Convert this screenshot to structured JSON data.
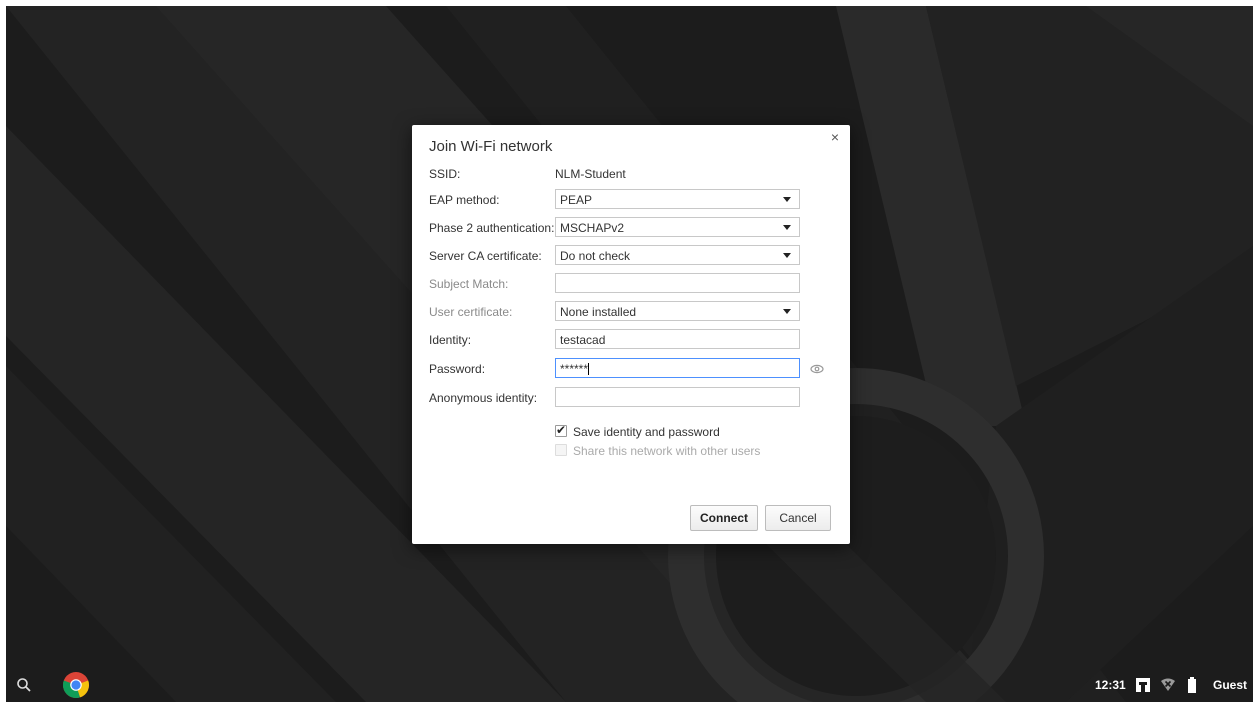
{
  "dialog": {
    "title": "Join Wi-Fi network",
    "close_symbol": "×",
    "ssid_label": "SSID:",
    "ssid_value": "NLM-Student",
    "eap_label": "EAP method:",
    "eap_value": "PEAP",
    "phase2_label": "Phase 2 authentication:",
    "phase2_value": "MSCHAPv2",
    "server_ca_label": "Server CA certificate:",
    "server_ca_value": "Do not check",
    "subject_match_label": "Subject Match:",
    "subject_match_value": "",
    "user_cert_label": "User certificate:",
    "user_cert_value": "None installed",
    "identity_label": "Identity:",
    "identity_value": "testacad",
    "password_label": "Password:",
    "password_value": "******",
    "anonymous_label": "Anonymous identity:",
    "anonymous_value": "",
    "save_identity_label": "Save identity and password",
    "save_identity_checked": true,
    "share_network_label": "Share this network with other users",
    "share_network_checked": false,
    "connect_label": "Connect",
    "cancel_label": "Cancel"
  },
  "shelf": {
    "search_icon": "search-icon",
    "browser_icon": "chrome-icon"
  },
  "tray": {
    "time": "12:31",
    "user": "Guest",
    "icons": [
      "network-icon",
      "wifi-disconnected-icon",
      "battery-icon"
    ]
  },
  "colors": {
    "focus_border": "#4d90fe",
    "wallpaper": "#1b1b1b"
  }
}
